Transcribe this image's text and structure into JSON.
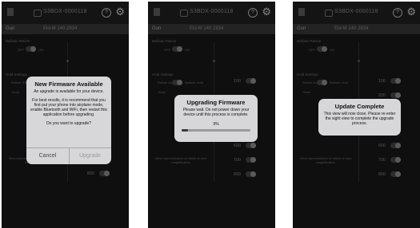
{
  "header": {
    "device_title": "S3BDX-0000118",
    "help_label": "?",
    "gun_label": "Gun",
    "gun_value": "Eld-M 140 2834"
  },
  "screen": {
    "ballistic_reticle": "Ballistic Reticle",
    "off": "OFF",
    "on": "ON",
    "hold_settings": "Hold Settings",
    "reticle_hold": "Reticle Hold",
    "ballistic_hold": "Ballistic Hold",
    "yards": "Yards",
    "ranges": [
      "100",
      "200",
      "300",
      "400",
      "500",
      "600",
      "700",
      "800"
    ],
    "view_representation": "View representation of reticle at max magnification"
  },
  "dialogs": {
    "firmware": {
      "title": "New Firmware Available",
      "subtitle": "An upgrade is available for your device.",
      "body": "For best results, it is recommend that you first put your phone into airplane mode, enable Bluetooth and WiFi, then restart this application before upgrading.",
      "question": "Do you want to upgrade?",
      "cancel": "Cancel",
      "upgrade": "Upgrade"
    },
    "upgrading": {
      "title": "Upgrading Firmware",
      "body": "Please wait. Do not power down your device until this process is complete.",
      "percent_label": "9%",
      "progress": 0.09
    },
    "complete": {
      "title": "Update Complete",
      "body": "This view will now close. Please re-enter the sight view to complete the upgrade process."
    }
  }
}
